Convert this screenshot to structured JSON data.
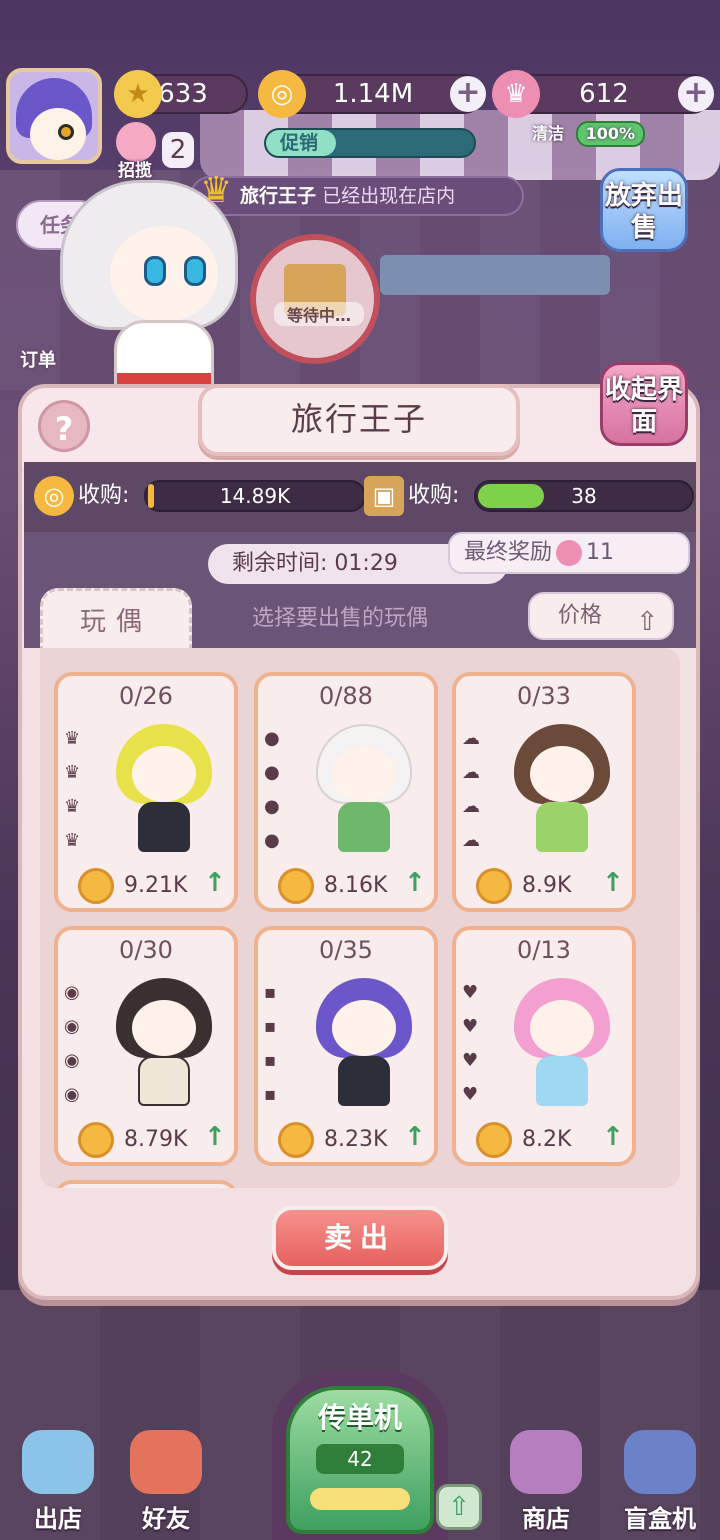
{
  "hud": {
    "stars": "633",
    "coins": "1.14M",
    "gems": "612",
    "invite_count": "2",
    "invite_label": "招揽",
    "promo_label": "促销",
    "clean_label": "清洁",
    "clean_percent": "100%",
    "task_label": "任务",
    "order_label": "订单"
  },
  "notice": {
    "name": "旅行王子",
    "text": "已经出现在店内"
  },
  "waiting_label": "等待中…",
  "side_buttons": {
    "abandon": "放弃出售",
    "collapse": "收起界面"
  },
  "panel": {
    "title": "旅行王子",
    "help": "?",
    "acquire_coin_label": "收购:",
    "acquire_coin_value": "14.89K",
    "acquire_box_label": "收购:",
    "acquire_box_value": "38",
    "timer_label": "剩余时间:",
    "timer_value": "01:29",
    "final_reward_label": "最终奖励",
    "final_reward_value": "11",
    "tab_label": "玩偶",
    "hint": "选择要出售的玩偶",
    "sort_label": "价格",
    "sell_button": "卖出"
  },
  "dolls": [
    {
      "count": "0/26",
      "price": "9.21K",
      "hair": "#e8e24a",
      "outfit": "#2e2e3a"
    },
    {
      "count": "0/88",
      "price": "8.16K",
      "hair": "#f4f2f2",
      "outfit": "#6fb86b"
    },
    {
      "count": "0/33",
      "price": "8.9K",
      "hair": "#6b4a3a",
      "outfit": "#9bd36a"
    },
    {
      "count": "0/30",
      "price": "8.79K",
      "hair": "#3a3030",
      "outfit": "#efe6d8"
    },
    {
      "count": "0/35",
      "price": "8.23K",
      "hair": "#6b57c9",
      "outfit": "#2e2e3a"
    },
    {
      "count": "0/13",
      "price": "8.2K",
      "hair": "#f39fd0",
      "outfit": "#9fd8f0"
    }
  ],
  "nav": {
    "leave": "出店",
    "friends": "好友",
    "flyer": "传单机",
    "flyer_count": "42",
    "shop": "商店",
    "blindbox": "盲盒机"
  }
}
